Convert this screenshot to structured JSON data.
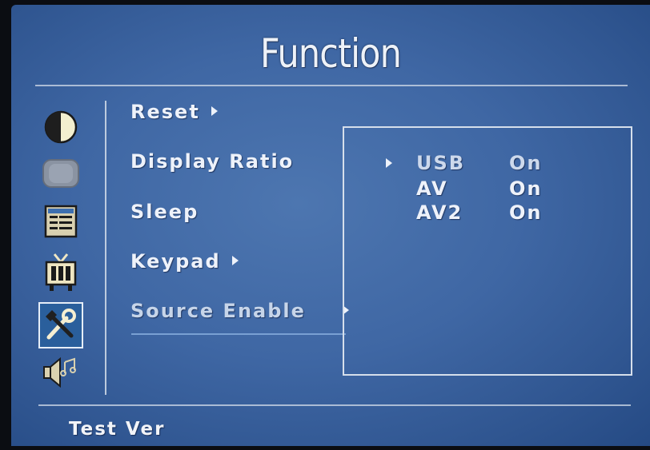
{
  "screen": {
    "title": "Function"
  },
  "sidebar": {
    "icons": [
      {
        "name": "contrast-icon",
        "selected": false
      },
      {
        "name": "monitor-icon",
        "selected": false
      },
      {
        "name": "osd-menu-icon",
        "selected": false
      },
      {
        "name": "tv-icon",
        "selected": false
      },
      {
        "name": "tools-icon",
        "selected": true
      },
      {
        "name": "sound-icon",
        "selected": false
      }
    ]
  },
  "menu": {
    "items": [
      {
        "label": "Reset",
        "has_arrow": true
      },
      {
        "label": "Display Ratio",
        "has_arrow": false
      },
      {
        "label": "Sleep",
        "has_arrow": false
      },
      {
        "label": "Keypad",
        "has_arrow": true
      },
      {
        "label": "Source Enable",
        "has_arrow": true,
        "active": true
      }
    ]
  },
  "submenu": {
    "rows": [
      {
        "label": "USB",
        "value": "On",
        "active": true
      },
      {
        "label": "AV",
        "value": "On"
      },
      {
        "label": "AV2",
        "value": "On"
      }
    ]
  },
  "footer": {
    "version_label": "Test Ver"
  }
}
